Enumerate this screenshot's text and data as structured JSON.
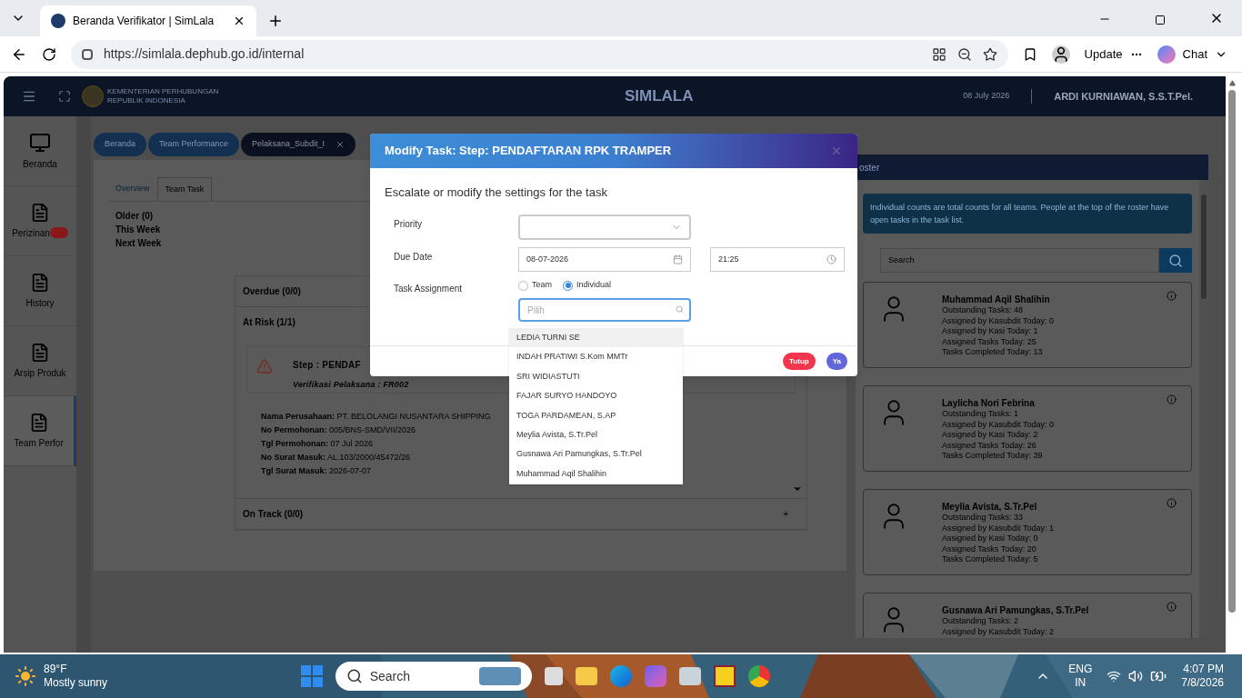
{
  "browser": {
    "tab_title": "Beranda Verifikator | SimLala",
    "url": "https://simlala.dephub.go.id/internal",
    "update_label": "Update",
    "chat_label": "Chat"
  },
  "header": {
    "org_line1": "KEMENTERIAN PERHUBUNGAN",
    "org_line2": "REPUBLIK INDONESIA",
    "app_name": "SIMLALA",
    "date": "08 July 2026",
    "user": "ARDI KURNIAWAN, S.S.T.Pel."
  },
  "sidebar": [
    {
      "label": "Beranda",
      "selected": false,
      "badge": false
    },
    {
      "label": "Perizinan",
      "selected": false,
      "badge": true
    },
    {
      "label": "History",
      "selected": false,
      "badge": false
    },
    {
      "label": "Arsip Produk",
      "selected": false,
      "badge": false
    },
    {
      "label": "Team Perfor",
      "selected": true,
      "badge": false
    }
  ],
  "breadcrumbs": [
    {
      "label": "Beranda",
      "selected": false,
      "closable": false
    },
    {
      "label": "Team Performance",
      "selected": false,
      "closable": false
    },
    {
      "label": "Pelaksana_Subdit_I",
      "selected": true,
      "closable": true
    }
  ],
  "content_tabs": [
    {
      "label": "Overview",
      "selected": false
    },
    {
      "label": "Team Task",
      "selected": true
    }
  ],
  "periods": [
    "Older (0)",
    "This Week",
    "Next Week"
  ],
  "sections": [
    {
      "title": "Overdue (0/0)"
    },
    {
      "title": "At Risk (1/1)",
      "task": {
        "step": "Step : PENDAF",
        "verifier": "Verifikasi Pelaksana : FR002",
        "details": [
          {
            "label": "Nama Perusahaan:",
            "value": "PT. BELOLANGI NUSANTARA SHIPPING"
          },
          {
            "label": "No Permohonan:",
            "value": "005/BNS-SMD/VII/2026"
          },
          {
            "label": "Tgl Permohonan:",
            "value": "07 Jul 2026"
          },
          {
            "label": "No Surat Masuk:",
            "value": "AL.103/2000/45472/26"
          },
          {
            "label": "Tgl Surat Masuk:",
            "value": "2026-07-07"
          }
        ]
      }
    },
    {
      "title": "On Track (0/0)",
      "toggle": "+"
    }
  ],
  "roster": {
    "title": "oster",
    "info": "Individual counts are total counts for all teams. People at the top of the roster have open tasks in the task list.",
    "search_placeholder": "Search",
    "people": [
      {
        "name": "Muhammad Aqil Shalihin",
        "stats": [
          "Outstanding Tasks: 48",
          "Assigned by Kasubdit Today: 0",
          "Assigned by Kasi Today: 1",
          "Assigned Tasks Today: 25",
          "Tasks Completed Today: 13"
        ]
      },
      {
        "name": "Laylicha Nori Febrina",
        "stats": [
          "Outstanding Tasks: 1",
          "Assigned by Kasubdit Today: 0",
          "Assigned by Kasi Today: 2",
          "Assigned Tasks Today: 26",
          "Tasks Completed Today: 39"
        ]
      },
      {
        "name": "Meylia Avista, S.Tr.Pel",
        "stats": [
          "Outstanding Tasks: 33",
          "Assigned by Kasubdit Today: 1",
          "Assigned by Kasi Today: 0",
          "Assigned Tasks Today: 20",
          "Tasks Completed Today: 5"
        ]
      },
      {
        "name": "Gusnawa Ari Pamungkas, S.Tr.Pel",
        "stats": [
          "Outstanding Tasks: 2",
          "Assigned by Kasubdit Today: 2"
        ]
      }
    ]
  },
  "modal": {
    "title": "Modify Task: Step: PENDAFTARAN RPK TRAMPER",
    "subtitle": "Escalate or modify the settings for the task",
    "priority_label": "Priority",
    "due_label": "Due Date",
    "due_date": "08-07-2026",
    "due_time": "21:25",
    "assign_label": "Task Assignment",
    "assign_options": [
      {
        "label": "Team",
        "selected": false
      },
      {
        "label": "Individual",
        "selected": true
      }
    ],
    "picker_placeholder": "Pilih",
    "options": [
      {
        "label": "LEDIA TURNI SE",
        "selected": true
      },
      {
        "label": "INDAH PRATIWI S.Kom MMTr",
        "selected": false
      },
      {
        "label": "SRI WIDIASTUTI",
        "selected": false
      },
      {
        "label": "FAJAR SURYO HANDOYO",
        "selected": false
      },
      {
        "label": "TOGA PARDAMEAN, S.AP",
        "selected": false
      },
      {
        "label": "Meylia Avista, S.Tr.Pel",
        "selected": false
      },
      {
        "label": "Gusnawa Ari Pamungkas, S.Tr.Pel",
        "selected": false
      },
      {
        "label": "Muhammad Aqil Shalihin",
        "selected": false
      }
    ],
    "buttons": [
      {
        "label": "Tutup",
        "kind": "cancel"
      },
      {
        "label": "Ya",
        "kind": "confirm"
      }
    ]
  },
  "taskbar": {
    "temperature": "89°F",
    "weather": "Mostly sunny",
    "search": "Search",
    "lang1": "ENG",
    "lang2": "IN",
    "time": "4:07 PM",
    "date": "7/8/2026"
  }
}
